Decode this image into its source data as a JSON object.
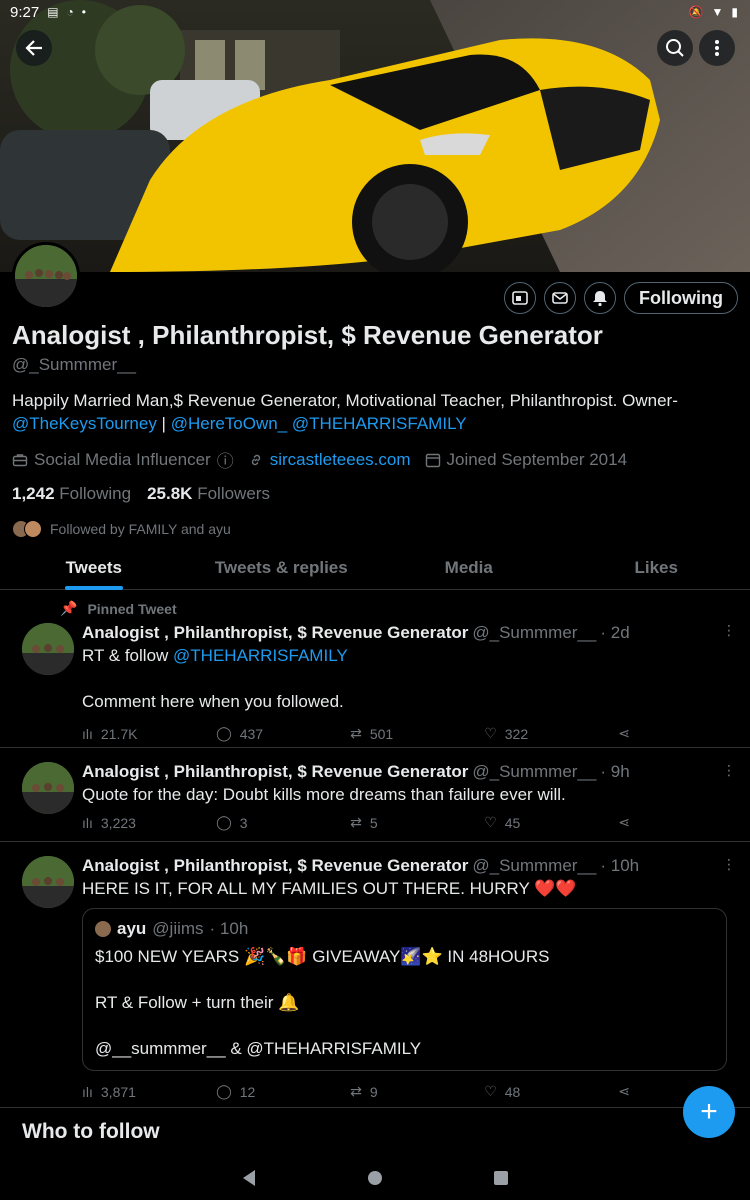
{
  "status_bar": {
    "time": "9:27"
  },
  "colors": {
    "accent": "#1d9bf0",
    "muted": "#71767b",
    "text": "#e7e9ea",
    "background": "#000000"
  },
  "banner": {
    "back_icon": "arrow-left-icon",
    "search_icon": "search-icon",
    "more_icon": "more-vertical-icon"
  },
  "profile": {
    "display_name": "Analogist , Philanthropist, $ Revenue Generator",
    "handle": "@_Summmer__",
    "bio_text": "Happily Married Man,$ Revenue Generator, Motivational Teacher, Philanthropist. Owner-",
    "bio_link1": "@TheKeysTourney",
    "bio_sep": " | ",
    "bio_link2": "@HereToOwn_",
    "bio_link3": "@THEHARRISFAMILY",
    "category": "Social Media Influencer",
    "website": "sircastleteees.com",
    "joined": "Joined September 2014",
    "following_count": "1,242",
    "following_label": "Following",
    "followers_count": "25.8K",
    "followers_label": "Followers",
    "followed_by": "Followed by FAMILY and ayu",
    "following_button": "Following"
  },
  "tabs": [
    {
      "label": "Tweets",
      "active": true
    },
    {
      "label": "Tweets & replies",
      "active": false
    },
    {
      "label": "Media",
      "active": false
    },
    {
      "label": "Likes",
      "active": false
    }
  ],
  "tweets": [
    {
      "pinned_label": "Pinned Tweet",
      "name": "Analogist , Philanthropist, $ Revenue Generator",
      "handle": "@_Summmer__",
      "time": "· 2d",
      "text_prefix": "RT & follow ",
      "text_link": "@THEHARRISFAMILY",
      "text2": "Comment here when you followed.",
      "views": "21.7K",
      "replies": "437",
      "retweets": "501",
      "likes": "322"
    },
    {
      "name": "Analogist , Philanthropist, $ Revenue Generator",
      "handle": "@_Summmer__",
      "time": "· 9h",
      "text": "Quote for the day: Doubt kills more dreams than failure ever will.",
      "views": "3,223",
      "replies": "3",
      "retweets": "5",
      "likes": "45"
    },
    {
      "name": "Analogist , Philanthropist, $ Revenue Generator",
      "handle": "@_Summmer__",
      "time": "· 10h",
      "text": "HERE IS IT, FOR ALL MY FAMILIES OUT THERE. HURRY ❤️❤️",
      "quote": {
        "name": "ayu",
        "handle": "@jiims",
        "time": "· 10h",
        "line1": "$100 NEW YEARS 🎉🍾🎁 GIVEAWAY🌠⭐ IN 48HOURS",
        "line2": "RT & Follow + turn their 🔔",
        "line3": "@__summmer__ & @THEHARRISFAMILY"
      },
      "views": "3,871",
      "replies": "12",
      "retweets": "9",
      "likes": "48"
    }
  ],
  "who_to_follow": "Who to follow"
}
